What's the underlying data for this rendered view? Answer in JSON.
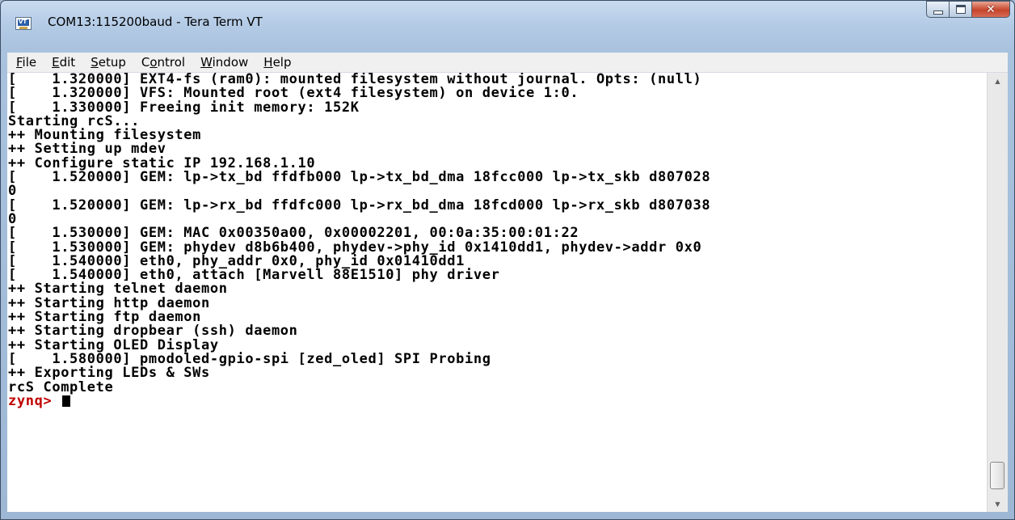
{
  "window": {
    "title": "COM13:115200baud - Tera Term VT"
  },
  "icons": {
    "app": "tera-term-vt-icon",
    "minimize": "minimize-icon",
    "maximize": "maximize-icon",
    "close": "close-icon",
    "scroll_up": "scroll-up-icon",
    "scroll_down": "scroll-down-icon"
  },
  "menu": [
    {
      "pre": "",
      "ul": "F",
      "post": "ile"
    },
    {
      "pre": "",
      "ul": "E",
      "post": "dit"
    },
    {
      "pre": "",
      "ul": "S",
      "post": "etup"
    },
    {
      "pre": "C",
      "ul": "o",
      "post": "ntrol"
    },
    {
      "pre": "",
      "ul": "W",
      "post": "indow"
    },
    {
      "pre": "",
      "ul": "H",
      "post": "elp"
    }
  ],
  "terminal": {
    "lines": [
      "[    1.320000] EXT4-fs (ram0): mounted filesystem without journal. Opts: (null)",
      "[    1.320000] VFS: Mounted root (ext4 filesystem) on device 1:0.",
      "[    1.330000] Freeing init memory: 152K",
      "Starting rcS...",
      "++ Mounting filesystem",
      "++ Setting up mdev",
      "++ Configure static IP 192.168.1.10",
      "[    1.520000] GEM: lp->tx_bd ffdfb000 lp->tx_bd_dma 18fcc000 lp->tx_skb d807028",
      "0",
      "[    1.520000] GEM: lp->rx_bd ffdfc000 lp->rx_bd_dma 18fcd000 lp->rx_skb d807038",
      "0",
      "[    1.530000] GEM: MAC 0x00350a00, 0x00002201, 00:0a:35:00:01:22",
      "[    1.530000] GEM: phydev d8b6b400, phydev->phy_id 0x1410dd1, phydev->addr 0x0",
      "[    1.540000] eth0, phy_addr 0x0, phy_id 0x01410dd1",
      "[    1.540000] eth0, attach [Marvell 88E1510] phy driver",
      "++ Starting telnet daemon",
      "++ Starting http daemon",
      "++ Starting ftp daemon",
      "++ Starting dropbear (ssh) daemon",
      "++ Starting OLED Display",
      "[    1.580000] pmodoled-gpio-spi [zed_oled] SPI Probing",
      "++ Exporting LEDs & SWs",
      "rcS Complete"
    ],
    "prompt": "zynq> "
  },
  "scrollbar": {
    "position": 0.93
  }
}
